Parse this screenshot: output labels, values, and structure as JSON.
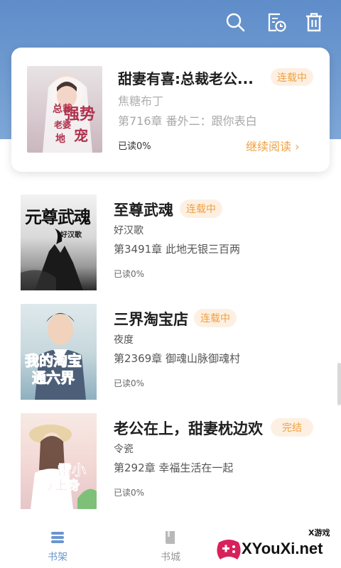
{
  "colors": {
    "header_bg": "#6b96cf",
    "accent": "#f0a040",
    "badge_bg": "#fdf0e3",
    "nav_active": "#6b96cf"
  },
  "toolbar": {
    "icons": [
      "search-icon",
      "history-icon",
      "trash-icon"
    ]
  },
  "featured": {
    "title": "甜妻有喜:总裁老公...",
    "status": "连载中",
    "author": "焦糖布丁",
    "chapter": "第716章 番外二：跟你表白",
    "progress": "已读0%",
    "continue_label": "继续阅读 ›",
    "cover_text": [
      "总裁",
      "强势",
      "宠",
      "老婆",
      "地"
    ]
  },
  "books": [
    {
      "title": "至尊武魂",
      "status": "连载中",
      "author": "好汉歌",
      "chapter": "第3491章 此地无银三百两",
      "progress": "已读0%",
      "cover_text": "元尊武魂",
      "cover_sub": "好汉歌"
    },
    {
      "title": "三界淘宝店",
      "status": "连载中",
      "author": "夜度",
      "chapter": "第2369章 御魂山脉御魂村",
      "progress": "已读0%",
      "cover_text_1": "我的淘宝",
      "cover_text_2": "通六界"
    },
    {
      "title": "老公在上，甜妻枕边欢",
      "status": "完结",
      "author": "令瓷",
      "chapter": "第292章 幸福生活在一起",
      "progress": "已读0%",
      "cover_text_1": "雷小",
      "cover_text_2": "欺上身"
    }
  ],
  "nav": {
    "shelf_label": "书架",
    "store_label": "书城"
  },
  "watermark": {
    "site": "XYouXi.net",
    "tag": "X游戏"
  }
}
